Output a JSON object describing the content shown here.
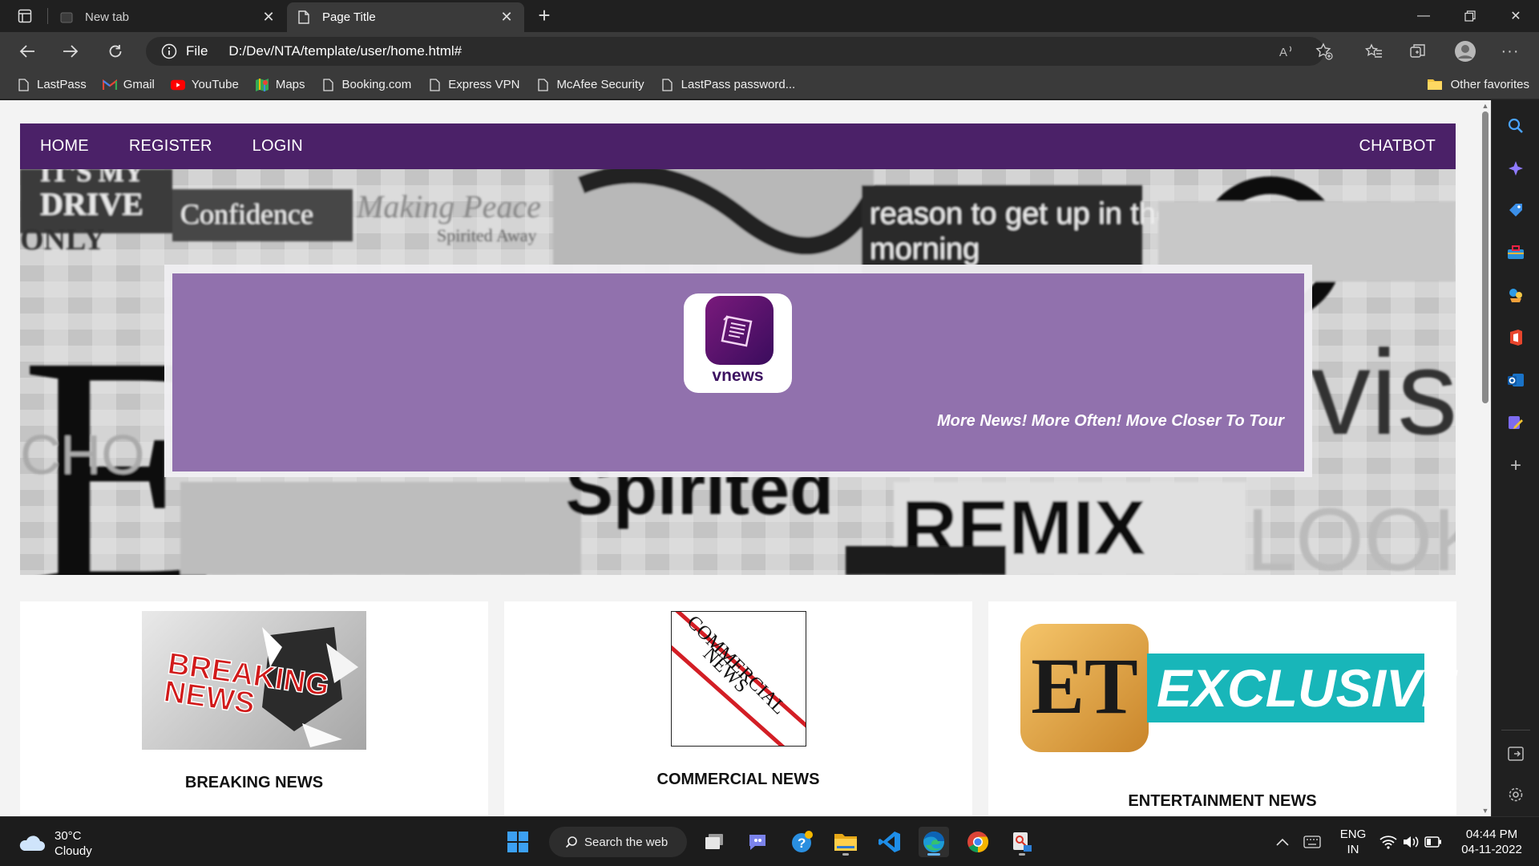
{
  "browser": {
    "tabs": [
      {
        "title": "New tab",
        "active": false
      },
      {
        "title": "Page Title",
        "active": true
      }
    ],
    "address": {
      "scheme": "File",
      "url": "D:/Dev/NTA/template/user/home.html#"
    },
    "favorites": [
      {
        "label": "LastPass",
        "icon": "page-icon"
      },
      {
        "label": "Gmail",
        "icon": "gmail-icon"
      },
      {
        "label": "YouTube",
        "icon": "youtube-icon"
      },
      {
        "label": "Maps",
        "icon": "maps-icon"
      },
      {
        "label": "Booking.com",
        "icon": "page-icon"
      },
      {
        "label": "Express VPN",
        "icon": "page-icon"
      },
      {
        "label": "McAfee Security",
        "icon": "page-icon"
      },
      {
        "label": "LastPass password...",
        "icon": "page-icon"
      }
    ],
    "other_favorites": "Other favorites"
  },
  "site": {
    "nav": {
      "home": "HOME",
      "register": "REGISTER",
      "login": "LOGIN",
      "chatbot": "CHATBOT"
    },
    "banner": {
      "logo_text": "vnews",
      "tagline": "More News! More Often! Move Closer To Tour"
    },
    "cards": [
      {
        "title": "BREAKING NEWS",
        "image_text": "BREAKING NEWS"
      },
      {
        "title": "COMMERCIAL NEWS",
        "image_text": "COMMERCIAL NEWS"
      },
      {
        "title": "ENTERTAINMENT NEWS",
        "image_text_1": "ET",
        "image_text_2": "EXCLUSIVE"
      }
    ],
    "hero_collage_words": [
      "IT'S MY",
      "DRIVE",
      "ONLY",
      "Confidence",
      "Making Peace",
      "Spirited Away",
      "reason to get up in the",
      "morning",
      "vist",
      "Spirited",
      "REMIX",
      "LOOK",
      "E",
      "CHO"
    ]
  },
  "taskbar": {
    "weather": {
      "temp": "30°C",
      "condition": "Cloudy"
    },
    "search_label": "Search the web",
    "language": {
      "lang": "ENG",
      "region": "IN"
    },
    "clock": {
      "time": "04:44 PM",
      "date": "04-11-2022"
    }
  },
  "colors": {
    "nav_purple": "#4b2168",
    "banner_purple": "#9171ad",
    "chrome_dark": "#202020",
    "chrome_mid": "#3a3a3a"
  }
}
